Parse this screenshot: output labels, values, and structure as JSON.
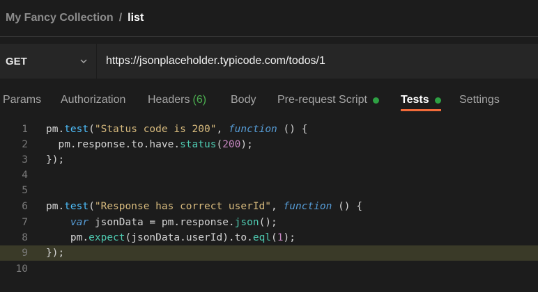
{
  "breadcrumb": {
    "collection": "My Fancy Collection",
    "separator": "/",
    "current": "list"
  },
  "request": {
    "method": "GET",
    "url": "https://jsonplaceholder.typicode.com/todos/1"
  },
  "tabs": [
    {
      "label": "Params"
    },
    {
      "label": "Authorization"
    },
    {
      "label": "Headers",
      "count": "(6)"
    },
    {
      "label": "Body"
    },
    {
      "label": "Pre-request Script",
      "has_dot": true
    },
    {
      "label": "Tests",
      "has_dot": true,
      "active": true
    },
    {
      "label": "Settings"
    }
  ],
  "editor": {
    "line_numbers": [
      "1",
      "2",
      "3",
      "4",
      "5",
      "6",
      "7",
      "8",
      "9",
      "10"
    ],
    "highlighted_line": "9",
    "lines": {
      "l1": {
        "a": "pm",
        "b": ".",
        "c": "test",
        "d": "(",
        "e": "\"Status code is 200\"",
        "f": ", ",
        "g": "function",
        "h": " () {"
      },
      "l2": {
        "a": "  pm",
        "b": ".response.to.have.",
        "c": "status",
        "d": "(",
        "e": "200",
        "f": ");"
      },
      "l3": {
        "a": "});"
      },
      "l6": {
        "a": "pm",
        "b": ".",
        "c": "test",
        "d": "(",
        "e": "\"Response has correct userId\"",
        "f": ", ",
        "g": "function",
        "h": " () {"
      },
      "l7": {
        "a": "    ",
        "b": "var",
        "c": " jsonData = ",
        "d": "pm",
        "e": ".response.",
        "f": "json",
        "g": "();"
      },
      "l8": {
        "a": "    pm",
        "b": ".",
        "c": "expect",
        "d": "(jsonData.userId).to.",
        "e": "eql",
        "f": "(",
        "g": "1",
        "h": ");"
      },
      "l9": {
        "a": "});"
      }
    }
  },
  "colors": {
    "accent_tab": "#f26b3a",
    "dot_green": "#2ea043",
    "background": "#1c1c1c"
  }
}
